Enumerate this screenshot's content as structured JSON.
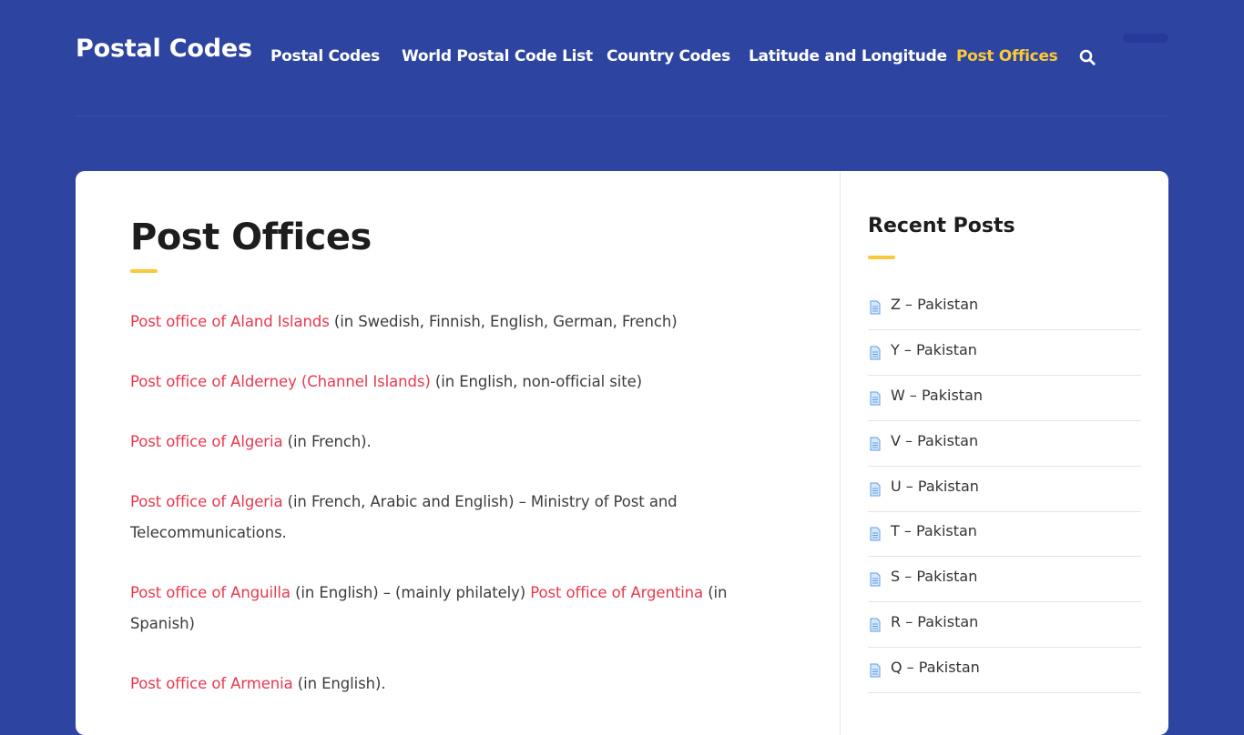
{
  "header": {
    "brand": "Postal Codes",
    "nav": [
      {
        "label": "Postal Codes",
        "active": false
      },
      {
        "label": "World Postal Code List",
        "active": false
      },
      {
        "label": "Country Codes",
        "active": false
      },
      {
        "label": "Latitude and Longitude",
        "active": false
      },
      {
        "label": "Post Offices",
        "active": true
      }
    ],
    "search_icon": "search-icon"
  },
  "main": {
    "title": "Post Offices",
    "entries": [
      {
        "parts": [
          {
            "link": "Post office of Aland Islands"
          },
          {
            "text": " (in Swedish, Finnish, English, German, French)"
          }
        ]
      },
      {
        "parts": [
          {
            "link": "Post office of Alderney (Channel Islands)"
          },
          {
            "text": " (in English, non-official site)"
          }
        ]
      },
      {
        "parts": [
          {
            "link": "Post office of Algeria"
          },
          {
            "text": " (in French)."
          }
        ]
      },
      {
        "parts": [
          {
            "link": "Post office of Algeria"
          },
          {
            "text": " (in French, Arabic and English) – Ministry of Post and Telecommunications."
          }
        ]
      },
      {
        "parts": [
          {
            "link": "Post office of Anguilla"
          },
          {
            "text": " (in English) – (mainly philately) "
          },
          {
            "link": "Post office of Argentina"
          },
          {
            "text": " (in Spanish)"
          }
        ]
      },
      {
        "parts": [
          {
            "link": "Post office of Armenia"
          },
          {
            "text": " (in English)."
          }
        ]
      }
    ]
  },
  "sidebar": {
    "title": "Recent Posts",
    "posts": [
      "Z – Pakistan",
      "Y – Pakistan",
      "W – Pakistan",
      "V – Pakistan",
      "U – Pakistan",
      "T – Pakistan",
      "S – Pakistan",
      "R – Pakistan",
      "Q – Pakistan"
    ],
    "post_icon": "document-icon"
  },
  "colors": {
    "background": "#2d44a0",
    "accent_yellow": "#f9c93a",
    "link_red": "#e8384f",
    "text_dark": "#1d1d1d"
  }
}
